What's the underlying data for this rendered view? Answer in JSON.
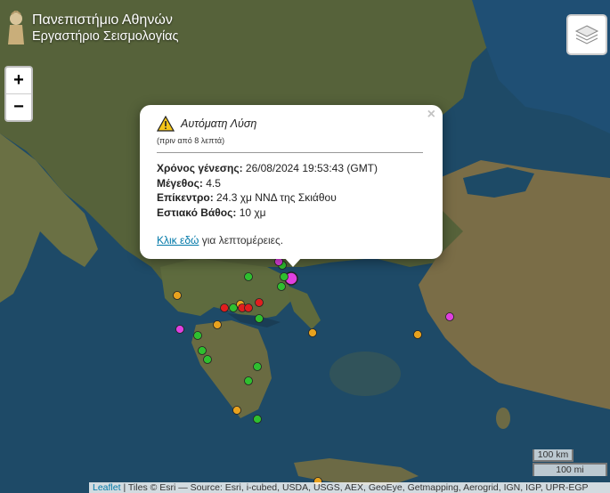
{
  "header": {
    "title_line1": "Πανεπιστήμιο Αθηνών",
    "title_line2": "Εργαστήριο Σεισμολογίας",
    "logo_icon": "university-athena-logo-icon"
  },
  "controls": {
    "zoom_in": "+",
    "zoom_out": "−",
    "layers_icon": "layers-icon"
  },
  "popup": {
    "close_label": "×",
    "warning_icon": "warning-triangle-icon",
    "type_label": "Αυτόματη Λύση",
    "ago": "(πριν από 8 λεπτά)",
    "origin_time_label": "Χρόνος γένεσης:",
    "origin_time_value": "26/08/2024 19:53:43 (GMT)",
    "magnitude_label": "Μέγεθος:",
    "magnitude_value": "4.5",
    "epicenter_label": "Επίκεντρο:",
    "epicenter_value": "24.3 χμ ΝΝΔ της Σκιάθου",
    "depth_label": "Εστιακό Βάθος:",
    "depth_value": "10 χμ",
    "link_text": "Κλικ εδώ",
    "link_suffix": "για λεπτομέρειες."
  },
  "scale": {
    "km": "100 km",
    "mi": "100 mi"
  },
  "attribution": {
    "leaflet": "Leaflet",
    "text": "| Tiles © Esri — Source: Esri, i-cubed, USDA, USGS, AEX, GeoEye, Getmapping, Aerogrid, IGN, IGP, UPR-EGP"
  },
  "colors": {
    "sea": "#1f4b66",
    "land": "#5f6b3c",
    "green_marker": "#2fbf2f",
    "orange_marker": "#e8a21e",
    "red_marker": "#e01e1e",
    "magenta_marker": "#e040e0",
    "link": "#0078a8"
  },
  "markers": [
    {
      "color": "magenta",
      "label": "latest-event"
    },
    {
      "color": "green"
    },
    {
      "color": "green"
    },
    {
      "color": "green"
    },
    {
      "color": "green"
    },
    {
      "color": "green"
    },
    {
      "color": "green"
    },
    {
      "color": "green"
    },
    {
      "color": "green"
    },
    {
      "color": "green"
    },
    {
      "color": "green"
    },
    {
      "color": "green"
    },
    {
      "color": "green"
    },
    {
      "color": "orange"
    },
    {
      "color": "orange"
    },
    {
      "color": "orange"
    },
    {
      "color": "orange"
    },
    {
      "color": "orange"
    },
    {
      "color": "orange"
    },
    {
      "color": "orange"
    },
    {
      "color": "red"
    },
    {
      "color": "red"
    },
    {
      "color": "red"
    },
    {
      "color": "red"
    },
    {
      "color": "magenta"
    },
    {
      "color": "magenta"
    },
    {
      "color": "magenta"
    }
  ]
}
